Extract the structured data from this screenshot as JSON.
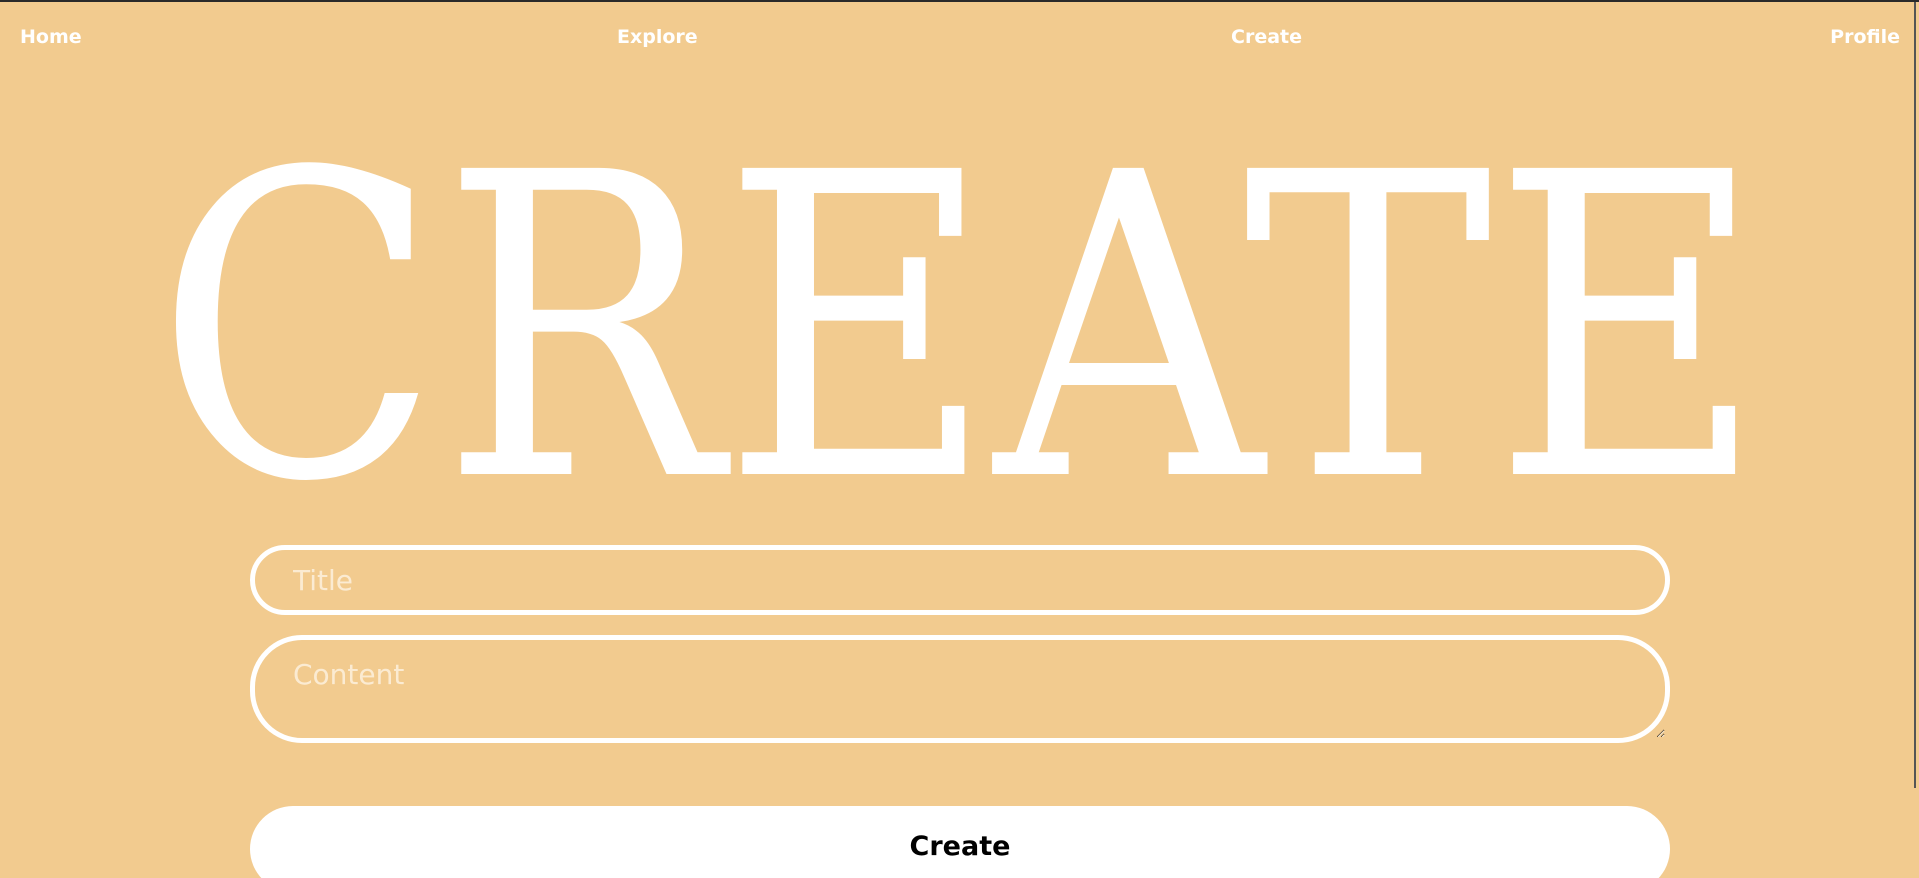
{
  "nav": {
    "items": [
      {
        "label": "Home"
      },
      {
        "label": "Explore"
      },
      {
        "label": "Create"
      },
      {
        "label": "Profile"
      }
    ]
  },
  "hero": {
    "title": "CREATE"
  },
  "form": {
    "title_placeholder": "Title",
    "title_value": "",
    "content_placeholder": "Content",
    "content_value": "",
    "submit_label": "Create"
  },
  "colors": {
    "background": "#f2cb8f",
    "foreground": "#ffffff",
    "button_text": "#000000"
  }
}
